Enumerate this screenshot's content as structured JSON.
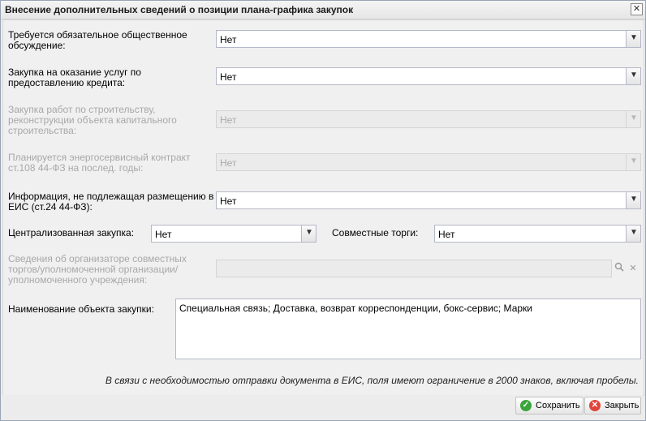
{
  "dialog": {
    "title": "Внесение дополнительных сведений о позиции плана-графика закупок",
    "close_glyph": "✕"
  },
  "fields": {
    "public_discussion": {
      "label_line1": "Требуется обязательное общественное",
      "label_line2": "обсуждение:",
      "value": "Нет"
    },
    "credit_services": {
      "label_line1": "Закупка на оказание услуг по",
      "label_line2": "предоставлению кредита:",
      "value": "Нет"
    },
    "construction": {
      "label_line1": "Закупка работ по строительству,",
      "label_line2": "реконструкции объекта капитального",
      "label_line3": "строительства:",
      "value": "Нет"
    },
    "energy_service": {
      "label_line1": "Планируется энергосервисный контракт",
      "label_line2": "ст.108 44-ФЗ на послед. годы:",
      "value": "Нет"
    },
    "not_published": {
      "label_line1": "Информация, не подлежащая размещению в",
      "label_line2": "ЕИС (ст.24 44-ФЗ):",
      "value": "Нет"
    },
    "centralized": {
      "label": "Централизованная закупка:",
      "value": "Нет"
    },
    "joint_auctions": {
      "label": "Совместные торги:",
      "value": "Нет"
    },
    "organizer": {
      "label_line1": "Сведения об организаторе совместных",
      "label_line2": "торгов/уполномоченной организации/",
      "label_line3": "уполномоченного учреждения:",
      "value": ""
    },
    "object_name": {
      "label": "Наименование объекта закупки:",
      "value": "Специальная связь; Доставка, возврат корреспонденции, бокс-сервис; Марки"
    }
  },
  "note": "В связи с необходимостью отправки документа в ЕИС, поля имеют ограничение в 2000 знаков, включая пробелы.",
  "footer": {
    "save_label": "Сохранить",
    "close_label": "Закрыть"
  },
  "icons": {
    "dropdown": "chevron-down-icon",
    "search": "search-icon",
    "clear": "clear-icon",
    "save": "check-circle-icon",
    "close": "close-circle-icon"
  },
  "colors": {
    "save_icon": "#3aa53a",
    "close_icon": "#e0453a",
    "disabled_text": "#a8a8a8"
  }
}
